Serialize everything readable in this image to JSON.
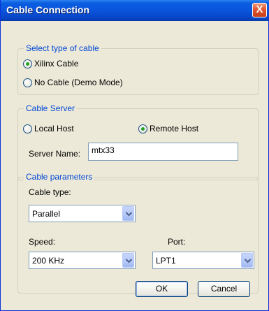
{
  "window": {
    "title": "Cable Connection",
    "close_label": "X"
  },
  "cable_type_group": {
    "legend": "Select type of cable",
    "options": [
      {
        "label": "Xilinx Cable",
        "checked": true
      },
      {
        "label": "No Cable (Demo Mode)",
        "checked": false
      }
    ]
  },
  "cable_server_group": {
    "legend": "Cable Server",
    "local_host_label": "Local Host",
    "remote_host_label": "Remote Host",
    "selected": "Remote Host",
    "server_name_label": "Server Name:",
    "server_name_value": "mtx33"
  },
  "cable_params_group": {
    "legend": "Cable parameters",
    "cable_type_label": "Cable type:",
    "cable_type_value": "Parallel",
    "speed_label": "Speed:",
    "speed_value": "200 KHz",
    "port_label": "Port:",
    "port_value": "LPT1"
  },
  "buttons": {
    "ok": "OK",
    "cancel": "Cancel"
  },
  "colors": {
    "title_bar": "#0a54dc",
    "legend_text": "#0046d5",
    "dialog_bg": "#ece9d8"
  }
}
